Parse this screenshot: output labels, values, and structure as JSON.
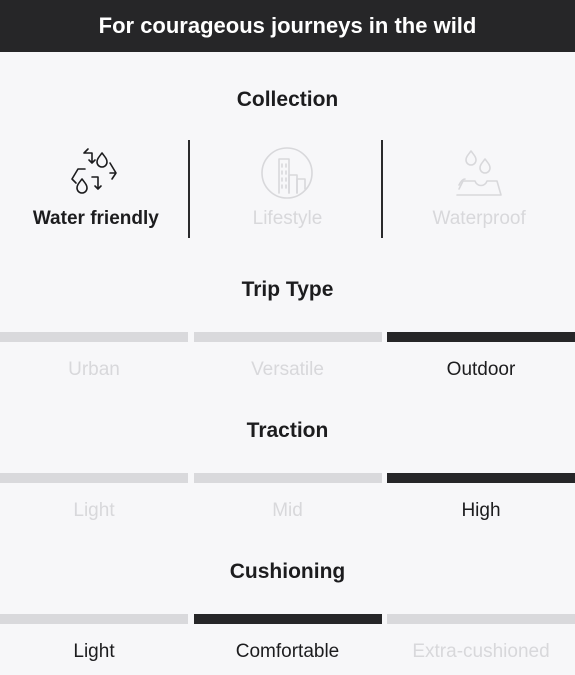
{
  "banner": {
    "text": "For courageous journeys in the wild"
  },
  "collection": {
    "title": "Collection",
    "items": [
      {
        "label": "Water friendly",
        "icon": "water-cycle-icon",
        "active": true
      },
      {
        "label": "Lifestyle",
        "icon": "city-building-icon",
        "active": false
      },
      {
        "label": "Waterproof",
        "icon": "waterproof-drops-icon",
        "active": false
      }
    ]
  },
  "trip_type": {
    "title": "Trip Type",
    "options": [
      "Urban",
      "Versatile",
      "Outdoor"
    ],
    "selected": "Outdoor"
  },
  "traction": {
    "title": "Traction",
    "options": [
      "Light",
      "Mid",
      "High"
    ],
    "selected": "High"
  },
  "cushioning": {
    "title": "Cushioning",
    "options": [
      "Light",
      "Comfortable",
      "Extra-cushioned"
    ],
    "selected": "Comfortable"
  },
  "colors": {
    "dark": "#262628",
    "inactive_bar": "#d9d9dc",
    "inactive_text": "#d8d8db",
    "background": "#f7f7f9"
  }
}
